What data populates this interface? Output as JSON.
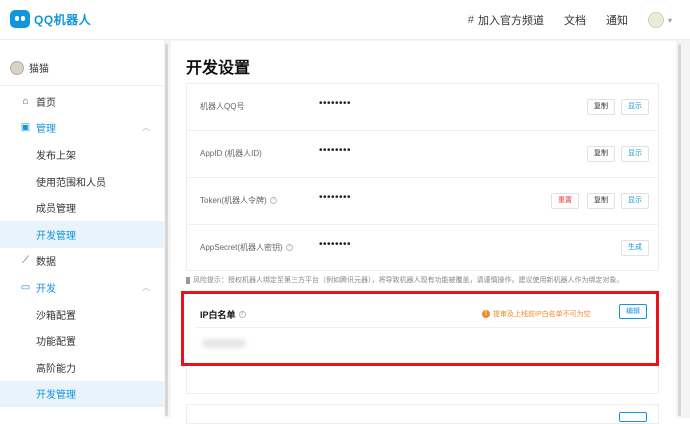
{
  "app": {
    "logo_text": "QQ机器人"
  },
  "topnav": {
    "channel_label": "加入官方频道",
    "docs_label": "文档",
    "notify_label": "通知"
  },
  "user": {
    "name": "猫猫"
  },
  "sidebar": {
    "items": [
      {
        "label": "首页",
        "icon": "home-icon"
      },
      {
        "label": "管理",
        "icon": "manage-icon"
      },
      {
        "label": "发布上架"
      },
      {
        "label": "使用范围和人员"
      },
      {
        "label": "成员管理"
      },
      {
        "label": "开发管理"
      },
      {
        "label": "数据",
        "icon": "data-icon"
      },
      {
        "label": "开发",
        "icon": "dev-icon"
      },
      {
        "label": "沙箱配置"
      },
      {
        "label": "功能配置"
      },
      {
        "label": "高阶能力"
      },
      {
        "label": "开发管理"
      }
    ]
  },
  "page": {
    "title": "开发设置"
  },
  "settings": {
    "rows": [
      {
        "label": "机器人QQ号",
        "value": "••••••••",
        "buttons": [
          "复制",
          "显示"
        ]
      },
      {
        "label": "AppID (机器人ID)",
        "value": "••••••••",
        "buttons": [
          "复制",
          "显示"
        ]
      },
      {
        "label": "Token(机器人令牌)",
        "value": "••••••••",
        "buttons": [
          "重置",
          "复制",
          "显示"
        ]
      },
      {
        "label": "AppSecret(机器人密钥)",
        "value": "••••••••",
        "buttons": [
          "生成"
        ]
      }
    ]
  },
  "risk_notice": "风险提示：授权机器人绑定至第三方平台（例如腾讯元器），将导致机器人现有功能被覆盖，请谨慎操作。建议使用新机器人作为绑定对象。",
  "ip_whitelist": {
    "title": "IP白名单",
    "warning": "提审及上线前IP白名单不可为空",
    "edit_label": "编辑"
  },
  "colors": {
    "accent": "#1296db",
    "highlight_border": "#e4131c",
    "warning": "#ef8a2b",
    "danger": "#e53935"
  }
}
